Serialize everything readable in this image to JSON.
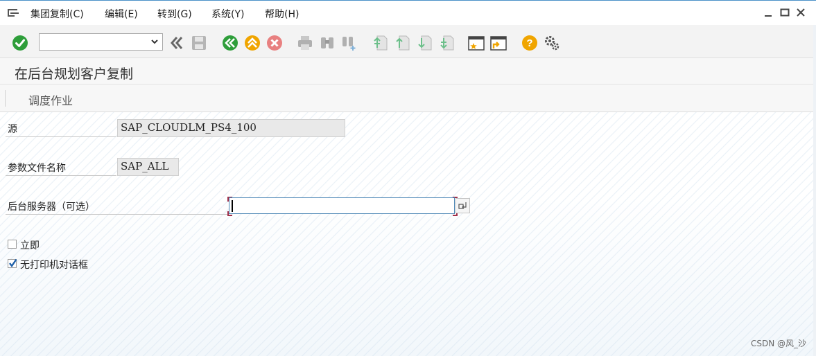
{
  "menu": {
    "items": [
      {
        "label": "集团复制(C)"
      },
      {
        "label": "编辑(E)"
      },
      {
        "label": "转到(G)"
      },
      {
        "label": "系统(Y)"
      },
      {
        "label": "帮助(H)"
      }
    ]
  },
  "toolbar": {
    "command_field_value": ""
  },
  "title": "在后台规划客户复制",
  "app_toolbar": {
    "schedule_job": "调度作业"
  },
  "form": {
    "source_label": "源",
    "source_value": "SAP_CLOUDLM_PS4_100",
    "profile_label": "参数文件名称",
    "profile_value": "SAP_ALL",
    "server_label": "后台服务器（可选）",
    "server_value": "",
    "immediate_label": "立即",
    "immediate_checked": false,
    "no_print_dialog_label": "无打印机对话框",
    "no_print_dialog_checked": true
  },
  "watermark": "CSDN @风_沙",
  "colors": {
    "accent_green": "#2e9e3a",
    "accent_orange": "#f0a500",
    "accent_red": "#e06060",
    "field_border": "#4c86b5"
  }
}
